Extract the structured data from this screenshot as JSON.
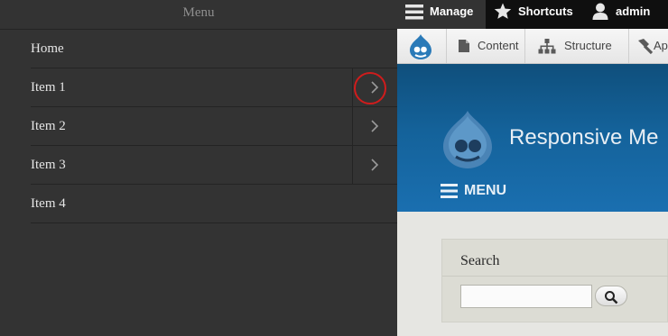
{
  "offcanvas_menu": {
    "title": "Menu",
    "items": [
      {
        "label": "Home",
        "has_children": false
      },
      {
        "label": "Item 1",
        "has_children": true
      },
      {
        "label": "Item 2",
        "has_children": true
      },
      {
        "label": "Item 3",
        "has_children": true
      },
      {
        "label": "Item 4",
        "has_children": false
      }
    ]
  },
  "admin_toolbar": {
    "manage": "Manage",
    "shortcuts": "Shortcuts",
    "user": "admin"
  },
  "tray": {
    "items": [
      "Content",
      "Structure",
      "Ap"
    ]
  },
  "site": {
    "name": "Responsive Me",
    "menu_toggle": "MENU"
  },
  "search_block": {
    "title": "Search",
    "input_value": ""
  },
  "colors": {
    "offcanvas_bg": "#333333",
    "highlight": "#d01c1c",
    "header_blue": "#14629a",
    "drupal_blue": "#2a7ab8"
  }
}
